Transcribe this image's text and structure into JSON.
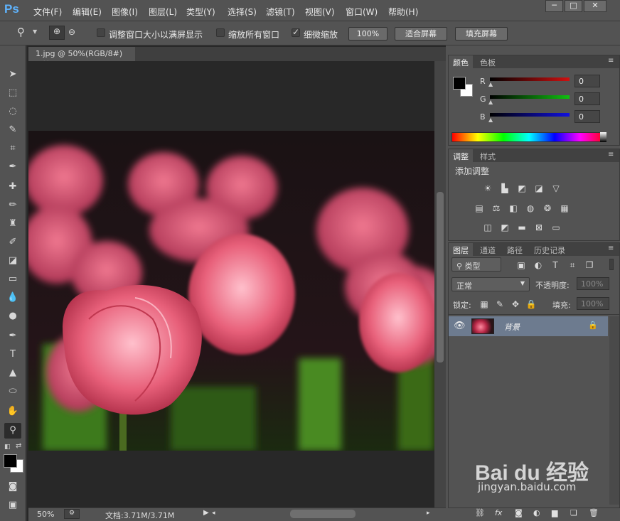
{
  "app": {
    "logo": "Ps"
  },
  "menu": [
    "文件(F)",
    "编辑(E)",
    "图像(I)",
    "图层(L)",
    "类型(Y)",
    "选择(S)",
    "滤镜(T)",
    "视图(V)",
    "窗口(W)",
    "帮助(H)"
  ],
  "window_controls": {
    "minimize": "─",
    "restore": "□",
    "close": "✕"
  },
  "options": {
    "resize_windows_label": "调整窗口大小以满屏显示",
    "resize_windows_checked": false,
    "zoom_all_label": "缩放所有窗口",
    "zoom_all_checked": false,
    "scrubby_zoom_label": "细微缩放",
    "scrubby_zoom_checked": true,
    "btn_100": "100%",
    "btn_fit": "适合屏幕",
    "btn_fill": "填充屏幕"
  },
  "document": {
    "tab_title": "1.jpg @ 50%(RGB/8#)",
    "tab_close": "×"
  },
  "status": {
    "zoom": "50%",
    "doc_size": "文档:3.71M/3.71M"
  },
  "color_panel": {
    "tabs": [
      "颜色",
      "色板"
    ],
    "channels": [
      {
        "label": "R",
        "value": "0",
        "color": "#d01010"
      },
      {
        "label": "G",
        "value": "0",
        "color": "#10c010"
      },
      {
        "label": "B",
        "value": "0",
        "color": "#1010e0"
      }
    ],
    "foreground": "#000000",
    "background": "#ffffff"
  },
  "adjust_panel": {
    "tabs": [
      "调整",
      "样式"
    ],
    "heading": "添加调整"
  },
  "layers_panel": {
    "tabs": [
      "图层",
      "通道",
      "路径",
      "历史记录"
    ],
    "filter_kind": "类型",
    "blend_mode": "正常",
    "opacity_label": "不透明度:",
    "opacity_value": "100%",
    "lock_label": "锁定:",
    "fill_label": "填充:",
    "fill_value": "100%",
    "layers": [
      {
        "name": "背景",
        "visible": true,
        "locked": true
      }
    ]
  },
  "watermark": {
    "brand": "Bai du 经验",
    "url": "jingyan.baidu.com"
  }
}
